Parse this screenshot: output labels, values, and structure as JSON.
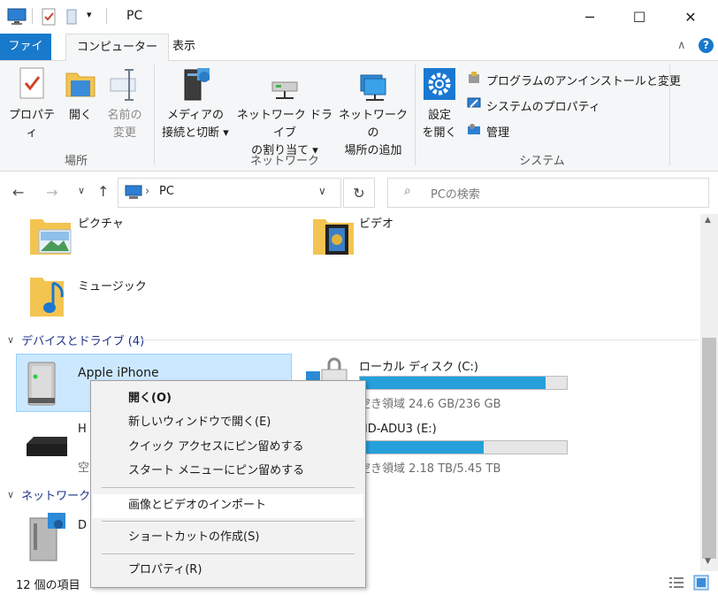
{
  "window": {
    "title": "PC",
    "controls": {
      "minimize": "─",
      "maximize": "☐",
      "close": "✕"
    }
  },
  "ribbon_tabs": [
    "ファイル",
    "コンピューター",
    "表示"
  ],
  "ribbon": {
    "groups": [
      {
        "label": "場所",
        "buttons": [
          {
            "line1": "プロパティ",
            "line2": ""
          },
          {
            "line1": "開く",
            "line2": ""
          },
          {
            "line1": "名前の",
            "line2": "変更"
          }
        ]
      },
      {
        "label": "ネットワーク",
        "buttons": [
          {
            "line1": "メディアの",
            "line2": "接続と切断 ▾"
          },
          {
            "line1": "ネットワーク ドライブ",
            "line2": "の割り当て ▾"
          },
          {
            "line1": "ネットワークの",
            "line2": "場所の追加"
          }
        ]
      },
      {
        "label": "システム",
        "buttons": [
          {
            "line1": "設定",
            "line2": "を開く"
          }
        ],
        "small_items": [
          "プログラムのアンインストールと変更",
          "システムのプロパティ",
          "管理"
        ]
      }
    ]
  },
  "nav": {
    "path": "PC",
    "search_placeholder": "PCの検索"
  },
  "folders": [
    {
      "label": "ピクチャ"
    },
    {
      "label": "ビデオ"
    },
    {
      "label": "ミュージック"
    }
  ],
  "devices_group": {
    "header": "デバイスとドライブ (4)"
  },
  "devices": [
    {
      "name": "Apple iPhone",
      "free": "",
      "used_fraction": null
    },
    {
      "name": "ローカル ディスク (C:)",
      "free": "空き領域 24.6 GB/236 GB",
      "used_fraction": 0.896
    },
    {
      "name": "H",
      "free": "空",
      "used_fraction": null
    },
    {
      "name": "HD-ADU3 (E:)",
      "free": "空き領域 2.18 TB/5.45 TB",
      "used_fraction": 0.6
    },
    {
      "name": "D",
      "free": "",
      "used_fraction": null
    }
  ],
  "network_group": {
    "header": "ネットワークの"
  },
  "status": {
    "count": "12 個の項目"
  },
  "context_menu": {
    "items": [
      {
        "label": "開く(O)",
        "bold": true
      },
      {
        "label": "新しいウィンドウで開く(E)",
        "bold": false
      },
      {
        "label": "クイック アクセスにピン留めする",
        "bold": false
      },
      {
        "label": "スタート メニューにピン留めする",
        "bold": false
      },
      {
        "label": "画像とビデオのインポート",
        "bold": false
      },
      {
        "label": "ショートカットの作成(S)",
        "bold": false
      },
      {
        "label": "プロパティ(R)",
        "bold": false
      }
    ],
    "hovered_index": 4
  },
  "colors": {
    "accent": "#1979ca",
    "selection": "#cce8ff",
    "drive_fill": "#26a0da"
  }
}
